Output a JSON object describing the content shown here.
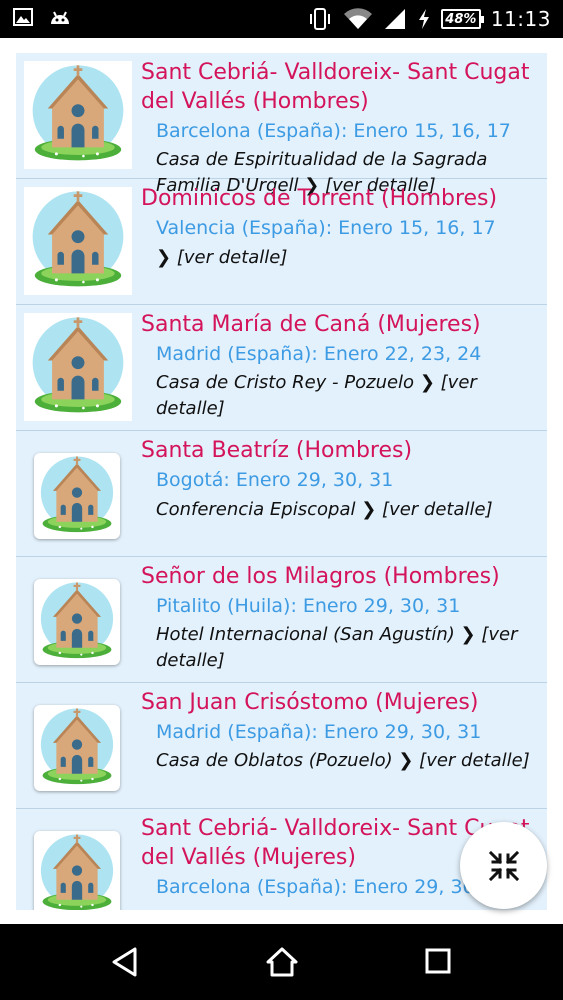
{
  "status_bar": {
    "battery": "48%",
    "time": "11:13"
  },
  "items": [
    {
      "title": "Sant Cebriá- Valldoreix- Sant Cugat del Vallés (Hombres)",
      "location": "Barcelona (España): Enero 15, 16, 17",
      "place": "Casa de Espiritualidad de la Sagrada Familia D'Urgell",
      "detail": "[ver detalle]"
    },
    {
      "title": "Dominicos de Torrent  (Hombres)",
      "location": "Valencia (España): Enero 15, 16, 17",
      "place": "",
      "detail": "[ver detalle]"
    },
    {
      "title": "Santa María de Caná (Mujeres)",
      "location": "Madrid (España): Enero 22, 23, 24",
      "place": "Casa de Cristo Rey - Pozuelo",
      "detail": "[ver detalle]"
    },
    {
      "title": "Santa Beatríz  (Hombres)",
      "location": "Bogotá: Enero 29, 30, 31",
      "place": "Conferencia Episcopal",
      "detail": "[ver detalle]"
    },
    {
      "title": "Señor de los Milagros (Hombres)",
      "location": "Pitalito (Huila): Enero 29, 30, 31",
      "place": "Hotel Internacional (San Agustín)",
      "detail": "[ver detalle]"
    },
    {
      "title": "San Juan Crisóstomo (Mujeres)",
      "location": "Madrid (España): Enero 29, 30, 31",
      "place": "Casa de Oblatos (Pozuelo)",
      "detail": "[ver detalle]"
    },
    {
      "title": "Sant Cebriá- Valldoreix- Sant Cugat del Vallés (Mujeres)",
      "location": "Barcelona (España): Enero 29, 30, 31",
      "place": "",
      "detail": ""
    }
  ],
  "chevron": "❯",
  "icons": {
    "thumbnail": "church-icon",
    "fab": "collapse-icon",
    "nav_back": "back-triangle-icon",
    "nav_home": "home-icon",
    "nav_recents": "recents-square-icon"
  },
  "colors": {
    "title": "#d4145a",
    "location": "#3d9be3",
    "list_background": "#e3f1fc"
  }
}
